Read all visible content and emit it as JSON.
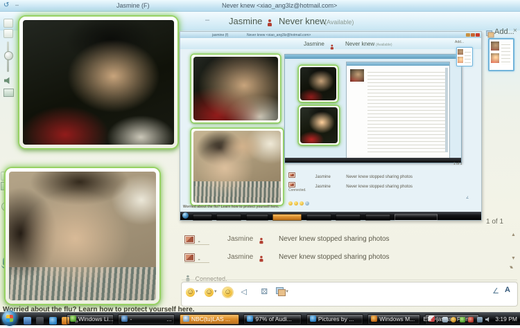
{
  "titlebar": {
    "title_left": "Jasmine (F)",
    "title_right": "Never knew <xiao_ang3lz@hotmail.com>"
  },
  "header": {
    "self_name": "Jasmine",
    "contact_name": "Never knew",
    "contact_status": "(Available)",
    "collapse_dash": "–"
  },
  "photo_sharing": {
    "page_indicator": "1 of 1",
    "add_label": "Add...",
    "close_label": "×"
  },
  "embedded_screenshot": {
    "title_left": "jasmine (f)",
    "title_right": "Never knew <xiao_ang3lz@hotmail.com>",
    "self_name": "Jasmine",
    "contact_name": "Never knew",
    "contact_status": "(Available)",
    "add_label": "Add...",
    "message_sender": "Jasmine",
    "message_text": "Never knew stopped sharing photos",
    "connected": "Connected.",
    "page_indicator": "1 of 1",
    "flu_notice": "Worried about the flu? Learn how to protect yourself here."
  },
  "messages": [
    {
      "sender": "Jasmine",
      "dash": "-",
      "text": "Never knew stopped sharing photos"
    },
    {
      "sender": "Jasmine",
      "dash": "-",
      "text": "Never knew stopped sharing photos"
    }
  ],
  "status": {
    "connected": "Connected."
  },
  "toolbar": {
    "font_button": "A"
  },
  "flu_notice": "Worried about the flu? Learn how to protect yourself here.",
  "taskbar": {
    "quick_launch_overflow": "»",
    "buttons": [
      {
        "label": "Windows Li..."
      },
      {
        "label": "-",
        "suffix": "..."
      },
      {
        "label": "NBC(tu)LAS ..."
      },
      {
        "label": "97% of Audi..."
      },
      {
        "label": "Pictures by ..."
      },
      {
        "label": "Windows M..."
      },
      {
        "label": "jasjas - Paint"
      }
    ],
    "tray": {
      "language": "EN",
      "collapse": "<",
      "clock": "3:19 PM"
    }
  },
  "glyphs": {
    "back": "↺",
    "dash": "–",
    "dropdown": "▾",
    "scroll_up": "▲",
    "scroll_down": "▼",
    "resize_grip": "▾▴",
    "smiley": "☺",
    "wink": "☺",
    "nudge": "☺",
    "die": "⚄",
    "pen": "∠"
  },
  "colors": {
    "webcam_glow_green": "#8fd05e",
    "aero_blue": "#c3e2f1",
    "taskbar_flash_orange": "#dd8f2d",
    "selection_blue": "#72b4da",
    "buddy_red": "#b23f31"
  }
}
